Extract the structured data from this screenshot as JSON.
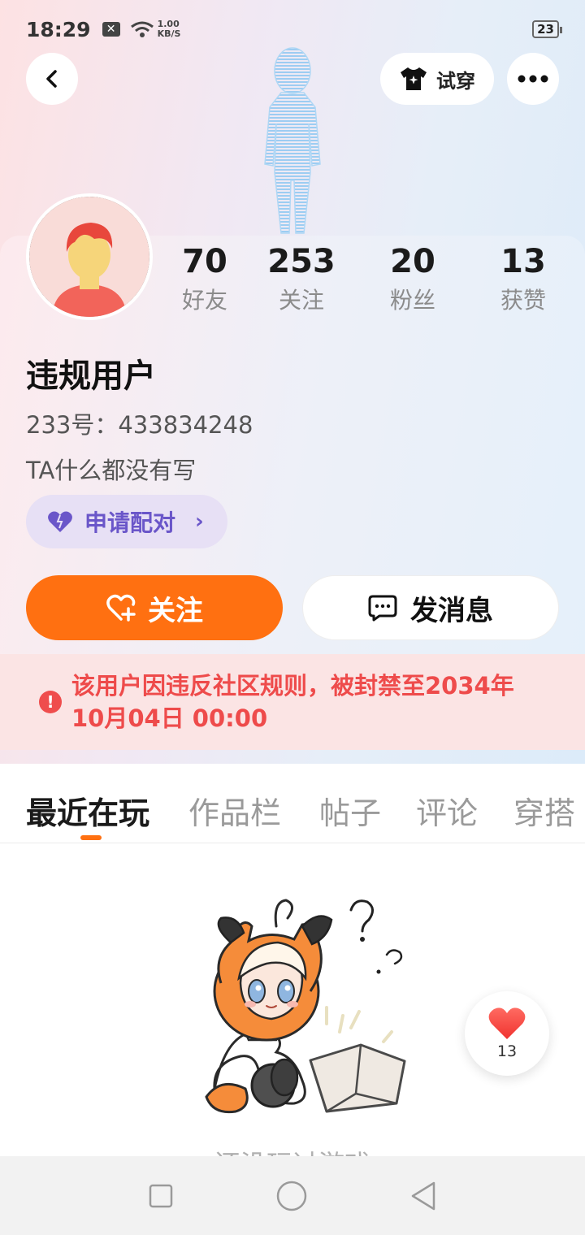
{
  "status_bar": {
    "time": "18:29",
    "net_speed_value": "1.00",
    "net_speed_unit": "KB/S",
    "battery": "23"
  },
  "header": {
    "try_on_label": "试穿"
  },
  "stats": [
    {
      "value": "70",
      "label": "好友"
    },
    {
      "value": "253",
      "label": "关注"
    },
    {
      "value": "20",
      "label": "粉丝"
    },
    {
      "value": "13",
      "label": "获赞"
    }
  ],
  "profile": {
    "name": "违规用户",
    "id_text": "233号：433834248",
    "bio": "TA什么都没有写",
    "pair_label": "申请配对"
  },
  "actions": {
    "follow_label": "关注",
    "message_label": "发消息"
  },
  "ban_notice": {
    "line1": "该用户因违反社区规则，被封禁至2034年",
    "line2": "10月04日 00:00"
  },
  "tabs": [
    "最近在玩",
    "作品栏",
    "帖子",
    "评论",
    "穿搭"
  ],
  "empty_state": {
    "text": "还没玩过游戏"
  },
  "like_float": {
    "count": "13"
  },
  "colors": {
    "accent": "#ff7011",
    "ban_text": "#ee4b4b",
    "pair_text": "#6a56c9"
  }
}
